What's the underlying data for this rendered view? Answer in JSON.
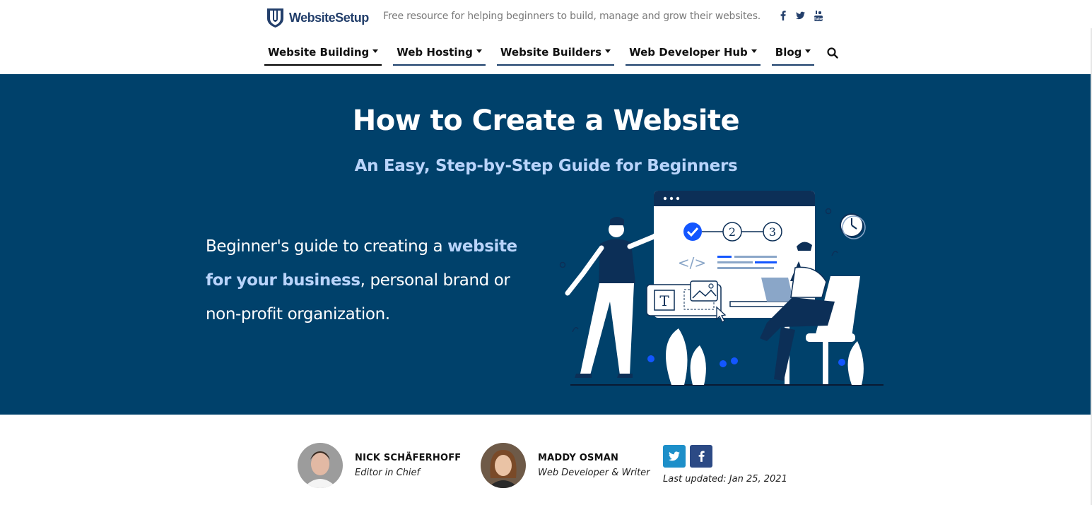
{
  "brand": {
    "name": "WebsiteSetup",
    "tagline": "Free resource for helping beginners to build, manage and grow their websites."
  },
  "social": [
    {
      "icon": "facebook-icon"
    },
    {
      "icon": "twitter-icon"
    },
    {
      "icon": "youtube-icon"
    }
  ],
  "nav": {
    "items": [
      {
        "label": "Website Building",
        "active": true
      },
      {
        "label": "Web Hosting",
        "active": false
      },
      {
        "label": "Website Builders",
        "active": false
      },
      {
        "label": "Web Developer Hub",
        "active": false
      },
      {
        "label": "Blog",
        "active": false
      }
    ],
    "search_icon": "search-icon"
  },
  "hero": {
    "title": "How to Create a Website",
    "subtitle": "An Easy, Step-by-Step Guide for Beginners",
    "text_part1": "Beginner's guide to creating a ",
    "text_bold": "website for your business",
    "text_part2": ", personal brand or non-profit organization.",
    "illustration": {
      "steps": [
        "2",
        "3"
      ],
      "code_symbol": "</>",
      "text_tool": "T"
    }
  },
  "authors": [
    {
      "name": "NICK SCHÄFERHOFF",
      "role": "Editor in Chief"
    },
    {
      "name": "MADDY OSMAN",
      "role": "Web Developer & Writer"
    }
  ],
  "share": [
    {
      "icon": "twitter-icon",
      "color": "#1d8fc9"
    },
    {
      "icon": "facebook-icon",
      "color": "#2c4a85"
    }
  ],
  "updated": "Last updated: Jan 25, 2021",
  "colors": {
    "hero_bg": "#00416b",
    "accent": "#b9d4fb",
    "brand": "#233f6b",
    "illustration_blue": "#1356ff"
  }
}
